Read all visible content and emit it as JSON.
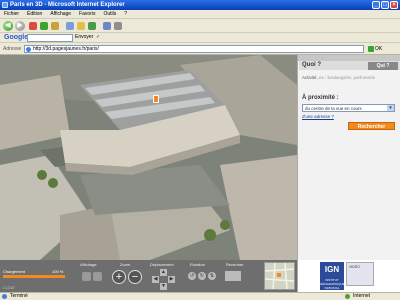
{
  "window": {
    "title": "Paris en 3D - Microsoft Internet Explorer"
  },
  "menu": [
    "Fichier",
    "Édition",
    "Affichage",
    "Favoris",
    "Outils",
    "?"
  ],
  "links_bar": {
    "search_engine": "Google",
    "go_label": "Envoyer",
    "check_label": "✓"
  },
  "address_bar": {
    "label": "Adresse",
    "url": "http://3d.pagesjaunes.fr/paris/",
    "go_label": "OK"
  },
  "side_panel": {
    "quoi_header": "Quoi ?",
    "quoi_tab": "Qui ?",
    "activity_label": "Activité,",
    "activity_hint": "ex.: boulangerie, parfumerie",
    "proximity_label": "À proximité :",
    "proximity_select": "du centre de la vue en cours",
    "address_link": "d'une adresse ?",
    "search_button": "Rechercher"
  },
  "controls": {
    "charge_label": "Chargement",
    "charge_percent": "100 %",
    "charge_fraction": 1.0,
    "labels": [
      "Affichage",
      "Zoom",
      "Déplacement",
      "Rotation",
      "Recentrer"
    ],
    "zoom_in": "+",
    "zoom_out": "−",
    "coords": "1.13.87"
  },
  "ign": {
    "logo": "IGN",
    "subtitle": "INSTITUT GÉOGRAPHIQUE NATIONAL",
    "video_label": "VIDÉO"
  },
  "status": {
    "left": "Terminé",
    "zone": "Internet"
  },
  "colors": {
    "accent": "#f28a1d",
    "title_bar": "#0a3fb8"
  }
}
